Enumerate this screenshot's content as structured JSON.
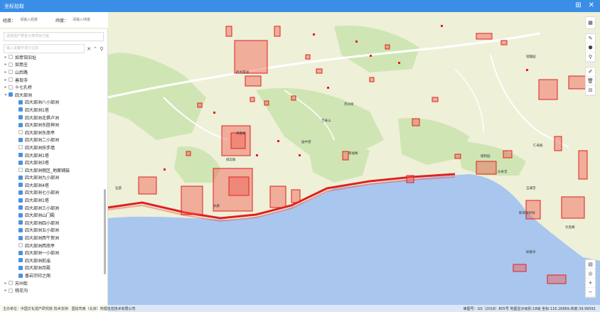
{
  "window": {
    "title": "坐标拾取"
  },
  "coords": {
    "lng_label": "经度：",
    "lng_placeholder": "请输入经度",
    "lat_label": "纬度：",
    "lat_placeholder": "请输入纬度"
  },
  "panel": {
    "combo_placeholder": "选择遗产要素分类项目已建",
    "search_placeholder": "输入关键字进行过滤"
  },
  "tree": [
    {
      "label": "如意馆旧址",
      "caret": true,
      "state": "off",
      "indent": 0
    },
    {
      "label": "如意庄",
      "caret": true,
      "state": "off",
      "indent": 0
    },
    {
      "label": "山后路",
      "caret": true,
      "state": "off",
      "indent": 0
    },
    {
      "label": "善现寺",
      "caret": true,
      "state": "off",
      "indent": 0
    },
    {
      "label": "十七孔桥",
      "caret": true,
      "state": "off",
      "indent": 0
    },
    {
      "label": "四大部洲",
      "caret": true,
      "state": "half",
      "indent": 0
    },
    {
      "label": "四大部洲八小部洲",
      "caret": false,
      "state": "on",
      "indent": 1
    },
    {
      "label": "四大部洲1塔",
      "caret": false,
      "state": "on",
      "indent": 1
    },
    {
      "label": "四大部洲北俱卢洲",
      "caret": false,
      "state": "on",
      "indent": 1
    },
    {
      "label": "四大部洲东胜神洲",
      "caret": false,
      "state": "on",
      "indent": 1
    },
    {
      "label": "四大部洲东南亭",
      "caret": false,
      "state": "off",
      "indent": 1
    },
    {
      "label": "四大部洲二小部洲",
      "caret": false,
      "state": "on",
      "indent": 1
    },
    {
      "label": "四大部洲扶手墙",
      "caret": false,
      "state": "off",
      "indent": 1
    },
    {
      "label": "四大部洲1塔",
      "caret": false,
      "state": "on",
      "indent": 1
    },
    {
      "label": "四大部洲3塔",
      "caret": false,
      "state": "on",
      "indent": 1
    },
    {
      "label": "四大部洲假区_地面铺装",
      "caret": false,
      "state": "off",
      "indent": 1
    },
    {
      "label": "四大部洲九小部洲",
      "caret": false,
      "state": "on",
      "indent": 1
    },
    {
      "label": "四大部洲4塔",
      "caret": false,
      "state": "on",
      "indent": 1
    },
    {
      "label": "四大部洲七小部洲",
      "caret": false,
      "state": "on",
      "indent": 1
    },
    {
      "label": "四大部洲1塔",
      "caret": false,
      "state": "on",
      "indent": 1
    },
    {
      "label": "四大部洲三小部洲",
      "caret": false,
      "state": "on",
      "indent": 1
    },
    {
      "label": "四大部洲山门殿",
      "caret": false,
      "state": "on",
      "indent": 1
    },
    {
      "label": "四大部洲四小部洲",
      "caret": false,
      "state": "on",
      "indent": 1
    },
    {
      "label": "四大部洲五小部洲",
      "caret": false,
      "state": "on",
      "indent": 1
    },
    {
      "label": "四大部洲西牛贺洲",
      "caret": false,
      "state": "on",
      "indent": 1
    },
    {
      "label": "四大部洲西南亭",
      "caret": false,
      "state": "off",
      "indent": 1
    },
    {
      "label": "四大部洲一小部洲",
      "caret": false,
      "state": "on",
      "indent": 1
    },
    {
      "label": "四大部洲前庙",
      "caret": false,
      "state": "on",
      "indent": 1
    },
    {
      "label": "四大部洲月殿",
      "caret": false,
      "state": "on",
      "indent": 1
    },
    {
      "label": "香岩宗印之阁",
      "caret": false,
      "state": "on",
      "indent": 1
    },
    {
      "label": "苏州街",
      "caret": true,
      "state": "off",
      "indent": 0
    },
    {
      "label": "桃花沟",
      "caret": true,
      "state": "off",
      "indent": 0
    }
  ],
  "map_labels": [
    {
      "text": "四大部洲",
      "id": "l1"
    },
    {
      "text": "谐趣园",
      "id": "l2"
    },
    {
      "text": "万寿山",
      "id": "l3"
    },
    {
      "text": "佛香阁",
      "id": "l4"
    },
    {
      "text": "苏州街",
      "id": "l5"
    },
    {
      "text": "石舫",
      "id": "l6"
    },
    {
      "text": "长廊",
      "id": "l7"
    },
    {
      "text": "排云殿",
      "id": "l8"
    },
    {
      "text": "德和园",
      "id": "l9"
    },
    {
      "text": "乐寿堂",
      "id": "l10"
    },
    {
      "text": "玉澜堂",
      "id": "l11"
    },
    {
      "text": "仁寿殿",
      "id": "l12"
    },
    {
      "text": "文昌阁",
      "id": "l13"
    },
    {
      "text": "知春亭",
      "id": "l14"
    },
    {
      "text": "耶律楚材祠",
      "id": "l15"
    },
    {
      "text": "景福阁",
      "id": "l16"
    },
    {
      "text": "画中游",
      "id": "l17"
    }
  ],
  "footer": {
    "left": "主办单位：中国文化遗产研究院  技术支持：国信司南（北京）地理信息技术有限公司",
    "right": "审图号：GS（2018）805号   地图显示级别:18级   坐标:116.26869,纬度:39.99591"
  },
  "colors": {
    "titlebar": "#3a8ee6",
    "water": "#a9c6ee",
    "land": "#eef0d8",
    "park": "#cfe6b4",
    "road": "#ffffff",
    "polygon_stroke": "#e02020",
    "polygon_fill": "rgba(240,90,80,0.45)"
  }
}
